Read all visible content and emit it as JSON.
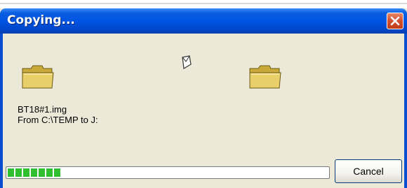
{
  "window": {
    "title": "Copying...",
    "file_name": "BT18#1.img",
    "from_to": "From C:\\TEMP to J:",
    "progress": 0.18,
    "cancel_label": "Cancel"
  },
  "icons": {
    "close": "close-icon",
    "source_folder": "folder-icon",
    "dest_folder": "folder-icon",
    "flying_paper": "paper-icon"
  },
  "colors": {
    "titlebar": "#0054e3",
    "close": "#d2502b",
    "progress_fill": "#2fbf2f",
    "dialog_bg": "#ece9d8"
  }
}
